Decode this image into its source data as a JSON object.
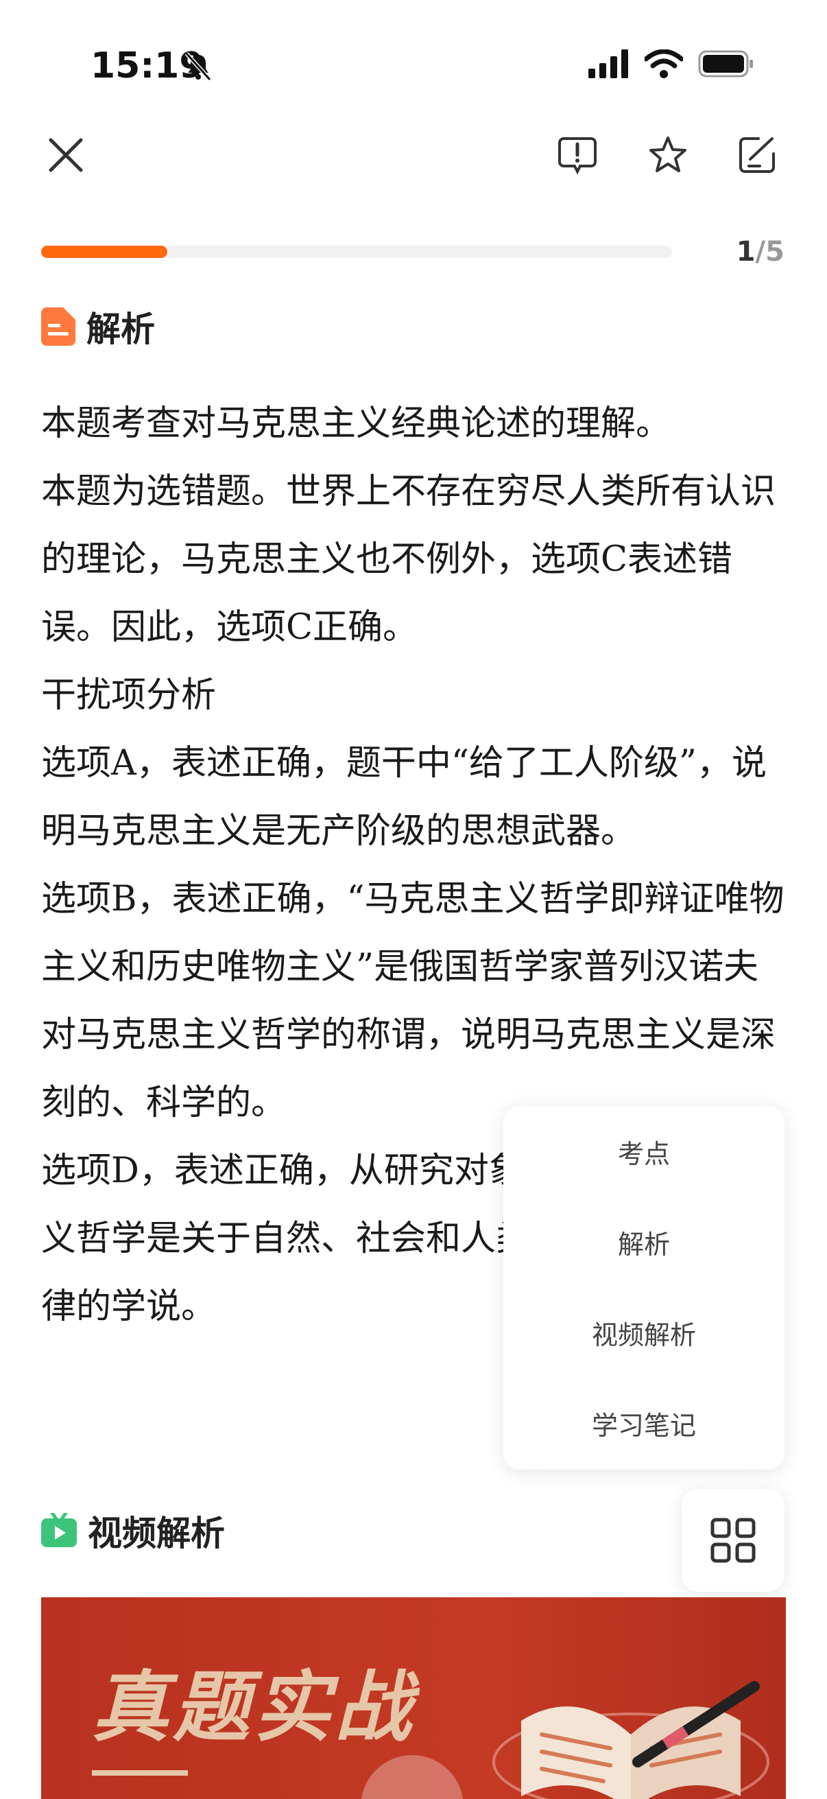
{
  "status": {
    "time": "15:19"
  },
  "progress": {
    "current": "1",
    "separator": "/",
    "total": "5",
    "fraction": 0.2
  },
  "analysis_section": {
    "title": "解析",
    "paragraphs": [
      "本题考查对马克思主义经典论述的理解。",
      "本题为选错题。世界上不存在穷尽人类所有认识的理论，马克思主义也不例外，选项C表述错误。因此，选项C正确。",
      "干扰项分析",
      "选项A，表述正确，题干中“给了工人阶级”，说明马克思主义是无产阶级的思想武器。",
      "选项B，表述正确，“马克思主义哲学即辩证唯物主义和历史唯物主义”是俄国哲学家普列汉诺夫对马克思主义哲学的称谓，说明马克思主义是深刻的、科学的。",
      "选项D，表述正确，从研究对象上看，马克思主义哲学是关于自然、社会和人类思维发展一般规律的学说。"
    ]
  },
  "popup_menu": {
    "items": [
      "考点",
      "解析",
      "视频解析",
      "学习笔记"
    ]
  },
  "video_section": {
    "title": "视频解析",
    "banner_title": "真题实战"
  },
  "colors": {
    "accent": "#ff6a0f",
    "video_icon": "#3cc57a",
    "banner": "#c43a24"
  }
}
